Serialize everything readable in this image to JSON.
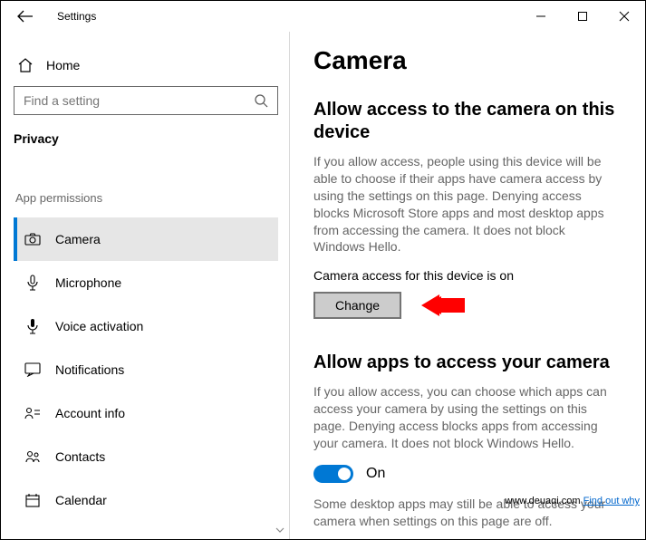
{
  "titlebar": {
    "label": "Settings"
  },
  "sidebar": {
    "home_label": "Home",
    "search_placeholder": "Find a setting",
    "section": "Privacy",
    "group_label": "App permissions",
    "items": [
      {
        "label": "Camera"
      },
      {
        "label": "Microphone"
      },
      {
        "label": "Voice activation"
      },
      {
        "label": "Notifications"
      },
      {
        "label": "Account info"
      },
      {
        "label": "Contacts"
      },
      {
        "label": "Calendar"
      }
    ]
  },
  "content": {
    "page_title": "Camera",
    "s1_heading": "Allow access to the camera on this device",
    "s1_body": "If you allow access, people using this device will be able to choose if their apps have camera access by using the settings on this page. Denying access blocks Microsoft Store apps and most desktop apps from accessing the camera. It does not block Windows Hello.",
    "status_line": "Camera access for this device is on",
    "change_label": "Change",
    "s2_heading": "Allow apps to access your camera",
    "s2_body": "If you allow access, you can choose which apps can access your camera by using the settings on this page. Denying access blocks apps from accessing your camera. It does not block Windows Hello.",
    "toggle_label": "On",
    "s3_body": "Some desktop apps may still be able to access your camera when settings on this page are off."
  },
  "attribution": {
    "site": "www.deuaqi.com",
    "link": "Find out why"
  }
}
